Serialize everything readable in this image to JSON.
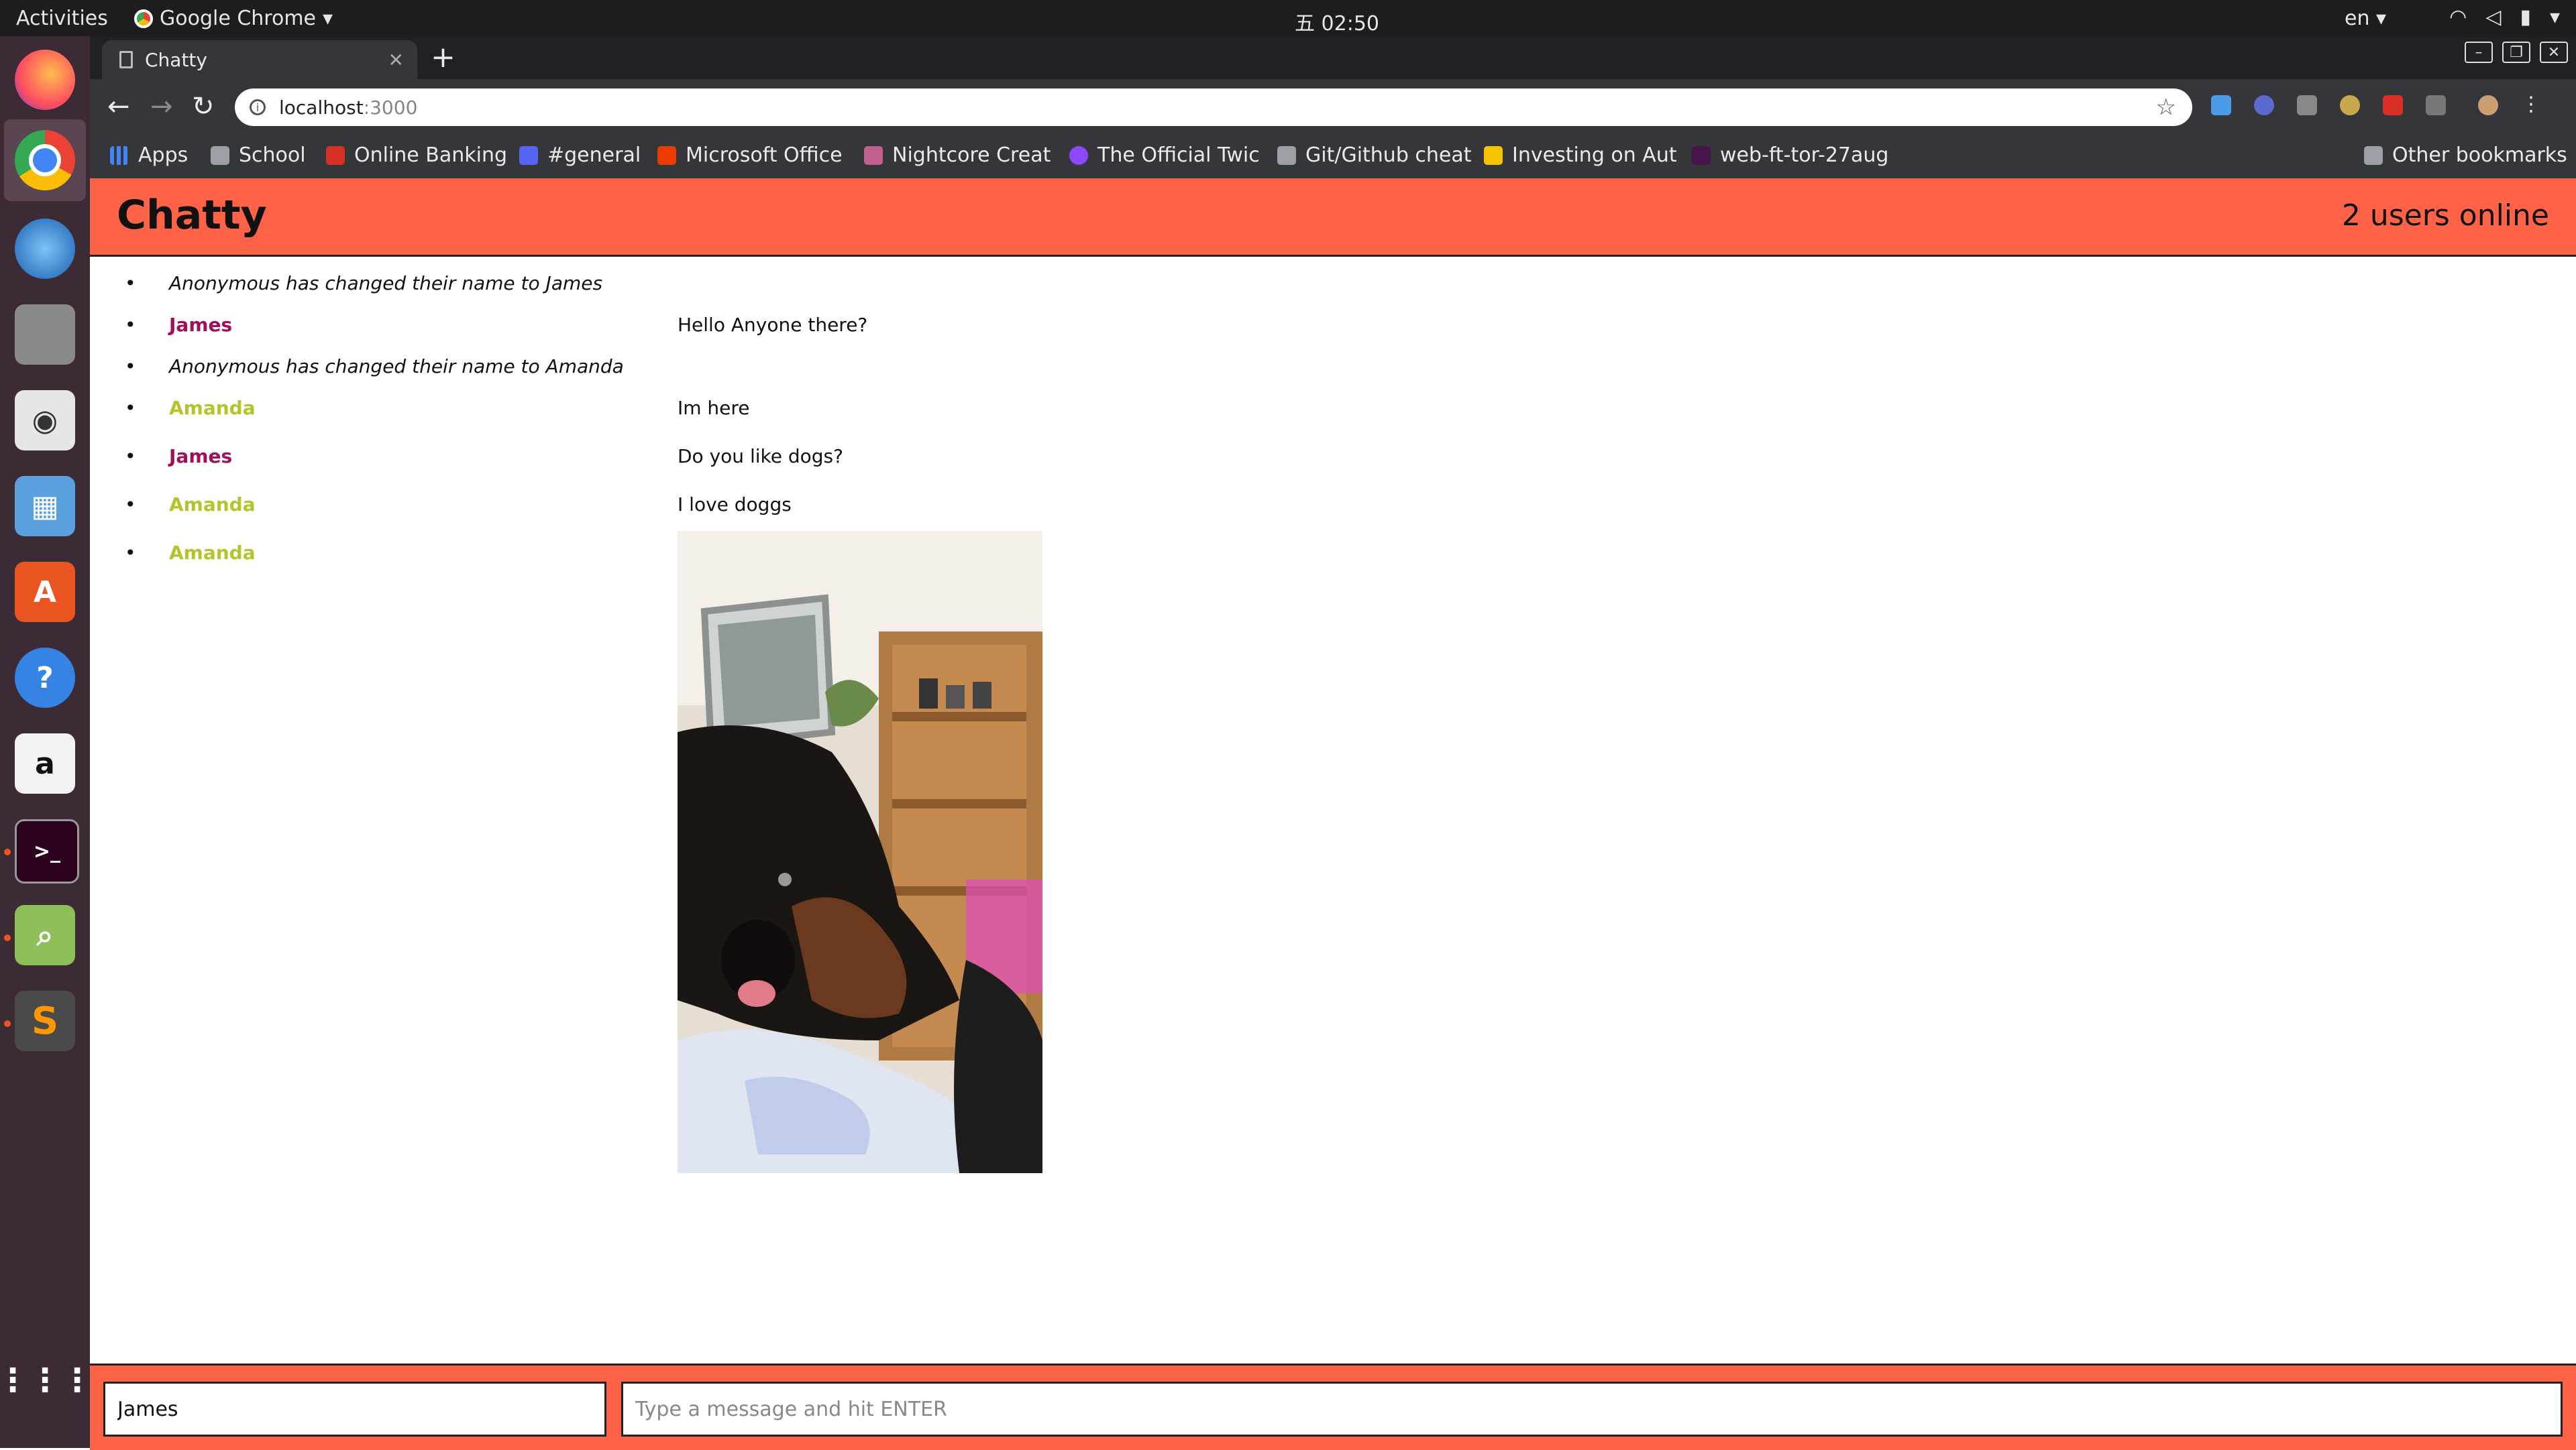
{
  "desktop": {
    "activities": "Activities",
    "app_name": "Google Chrome",
    "clock": "五 02:50",
    "lang": "en"
  },
  "browser": {
    "tab_title": "Chatty",
    "url_host": "localhost",
    "url_port": ":3000",
    "bookmarks": [
      {
        "label": "Apps",
        "icon": "apps-grid-icon",
        "color": "#4285f4"
      },
      {
        "label": "School",
        "icon": "folder-icon",
        "color": "#9aa0a6"
      },
      {
        "label": "Online Banking",
        "icon": "bank-icon",
        "color": "#d93025"
      },
      {
        "label": "#general",
        "icon": "discord-icon",
        "color": "#5865f2"
      },
      {
        "label": "Microsoft Office",
        "icon": "office-icon",
        "color": "#eb3c00"
      },
      {
        "label": "Nightcore Creat",
        "icon": "nightcore-icon",
        "color": "#c06090"
      },
      {
        "label": "The Official Twic",
        "icon": "twitch-icon",
        "color": "#9146ff"
      },
      {
        "label": "Git/Github cheat",
        "icon": "folder-icon",
        "color": "#9aa0a6"
      },
      {
        "label": "Investing on Aut",
        "icon": "investing-icon",
        "color": "#f5c400"
      },
      {
        "label": "web-ft-tor-27aug",
        "icon": "slack-icon",
        "color": "#4a154b"
      },
      {
        "label": "Other bookmarks",
        "icon": "folder-icon",
        "color": "#9aa0a6"
      }
    ]
  },
  "app": {
    "brand": "Chatty",
    "users_online": "2 users online",
    "colors": {
      "header": "#ff6347",
      "james": "#a0105a",
      "amanda": "#b5c42a"
    },
    "messages": [
      {
        "type": "system",
        "text": "Anonymous has changed their name to James"
      },
      {
        "type": "chat",
        "user": "James",
        "text": "Hello Anyone there?"
      },
      {
        "type": "system",
        "text": "Anonymous has changed their name to Amanda"
      },
      {
        "type": "chat",
        "user": "Amanda",
        "text": "Im here"
      },
      {
        "type": "chat",
        "user": "James",
        "text": "Do you like dogs?"
      },
      {
        "type": "chat",
        "user": "Amanda",
        "text": "I love doggs"
      },
      {
        "type": "image",
        "user": "Amanda"
      }
    ],
    "footer": {
      "name_value": "James",
      "message_placeholder": "Type a message and hit ENTER"
    }
  }
}
